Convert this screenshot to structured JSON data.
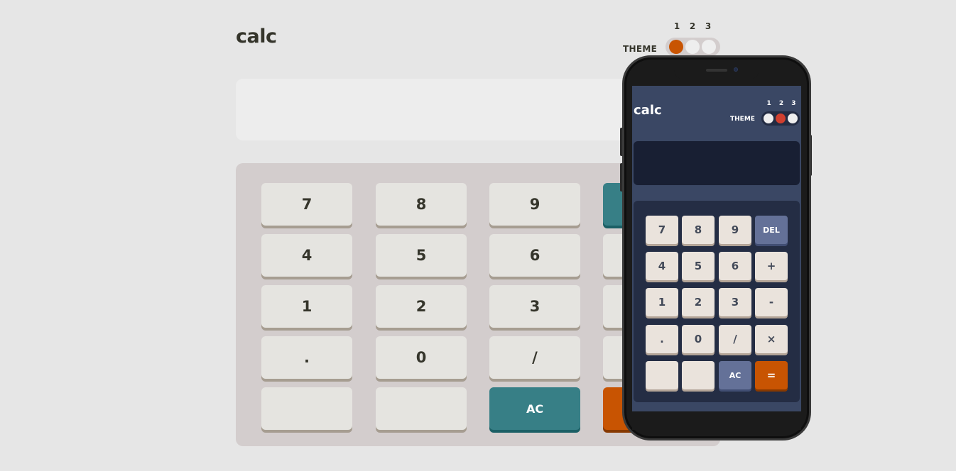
{
  "main": {
    "title": "calc",
    "theme_label": "THEME",
    "theme_numbers": [
      "1",
      "2",
      "3"
    ],
    "active_theme": 1,
    "display_value": "",
    "keys": [
      {
        "label": "7",
        "style": "default"
      },
      {
        "label": "8",
        "style": "default"
      },
      {
        "label": "9",
        "style": "default"
      },
      {
        "label": "",
        "style": "teal"
      },
      {
        "label": "4",
        "style": "default"
      },
      {
        "label": "5",
        "style": "default"
      },
      {
        "label": "6",
        "style": "default"
      },
      {
        "label": "",
        "style": "default"
      },
      {
        "label": "1",
        "style": "default"
      },
      {
        "label": "2",
        "style": "default"
      },
      {
        "label": "3",
        "style": "default"
      },
      {
        "label": "",
        "style": "default"
      },
      {
        "label": ".",
        "style": "default"
      },
      {
        "label": "0",
        "style": "default"
      },
      {
        "label": "/",
        "style": "default"
      },
      {
        "label": "",
        "style": "default"
      },
      {
        "label": "",
        "style": "default"
      },
      {
        "label": "",
        "style": "default"
      },
      {
        "label": "AC",
        "style": "teal"
      },
      {
        "label": "",
        "style": "orange"
      }
    ]
  },
  "phone": {
    "title": "calc",
    "theme_label": "THEME",
    "theme_numbers": [
      "1",
      "2",
      "3"
    ],
    "active_theme": 2,
    "display_value": "",
    "keys": [
      {
        "label": "7",
        "style": "default"
      },
      {
        "label": "8",
        "style": "default"
      },
      {
        "label": "9",
        "style": "default"
      },
      {
        "label": "DEL",
        "style": "slate"
      },
      {
        "label": "4",
        "style": "default"
      },
      {
        "label": "5",
        "style": "default"
      },
      {
        "label": "6",
        "style": "default"
      },
      {
        "label": "+",
        "style": "default"
      },
      {
        "label": "1",
        "style": "default"
      },
      {
        "label": "2",
        "style": "default"
      },
      {
        "label": "3",
        "style": "default"
      },
      {
        "label": "-",
        "style": "default"
      },
      {
        "label": ".",
        "style": "default"
      },
      {
        "label": "0",
        "style": "default"
      },
      {
        "label": "/",
        "style": "default"
      },
      {
        "label": "×",
        "style": "default"
      },
      {
        "label": "",
        "style": "default"
      },
      {
        "label": "",
        "style": "default"
      },
      {
        "label": "AC",
        "style": "slate"
      },
      {
        "label": "=",
        "style": "orange"
      }
    ]
  },
  "colors": {
    "page_bg": "#e6e6e6",
    "accent_orange": "#c85402",
    "accent_teal": "#377f86",
    "phone_theme_bg": "#3a4764",
    "phone_accent_slate": "#647198",
    "phone_toggle_active": "#d03f2f"
  }
}
